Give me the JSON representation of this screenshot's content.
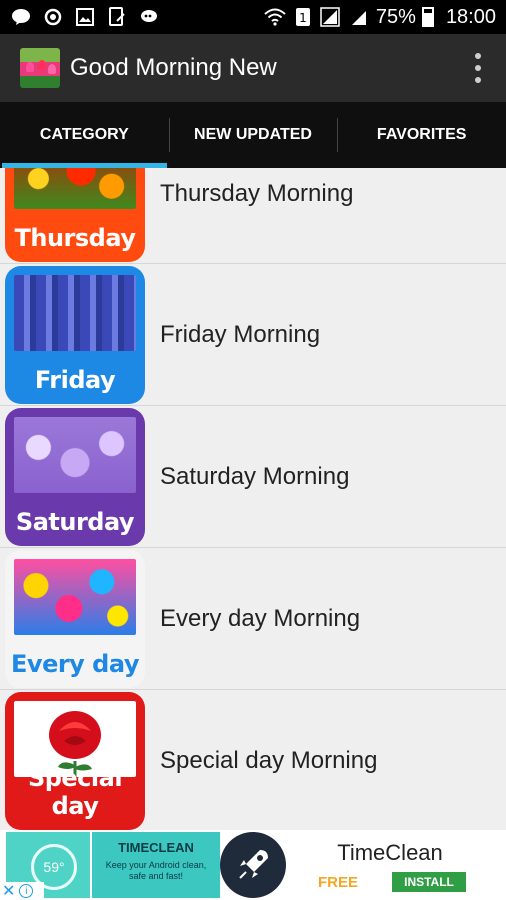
{
  "status_bar": {
    "battery": "75%",
    "time": "18:00"
  },
  "app_bar": {
    "title": "Good Morning New",
    "menu_icon": "overflow-menu-icon"
  },
  "tabs": [
    {
      "label": "CATEGORY",
      "active": true
    },
    {
      "label": "NEW UPDATED",
      "active": false
    },
    {
      "label": "FAVORITES",
      "active": false
    }
  ],
  "categories": [
    {
      "title": "Thursday Morning",
      "badge": "Thursday",
      "color": "#ff4a10"
    },
    {
      "title": "Friday Morning",
      "badge": "Friday",
      "color": "#1e88e5"
    },
    {
      "title": "Saturday Morning",
      "badge": "Saturday",
      "color": "#6a3aad"
    },
    {
      "title": "Every day Morning",
      "badge": "Every day",
      "color": "#1e88e5"
    },
    {
      "title": "Special day Morning",
      "badge": "Special day",
      "color": "#e01919"
    }
  ],
  "ad": {
    "gauge": "59°",
    "brand": "TIMECLEAN",
    "tagline": "Keep your Android clean, safe and fast!",
    "title": "TimeClean",
    "free_label": "FREE",
    "install_label": "INSTALL"
  }
}
